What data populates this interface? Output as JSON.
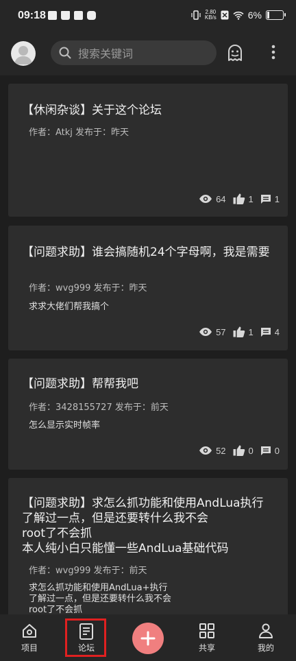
{
  "status_bar": {
    "time": "09:18",
    "speed_value": "2.80",
    "speed_unit": "KB/s",
    "battery": "6%"
  },
  "header": {
    "search_placeholder": "搜索关键词",
    "icons": [
      "avatar",
      "search-icon",
      "ghost-icon",
      "more-vertical-icon"
    ]
  },
  "posts": [
    {
      "title": "【休闲杂谈】关于这个论坛",
      "meta": "作者：Atkj  发布于：昨天",
      "excerpt_lines": [],
      "views": "64",
      "likes": "1",
      "comments": "1"
    },
    {
      "title": "【问题求助】谁会搞随机24个字母啊，我是需要",
      "meta": "作者：wvg999  发布于：昨天",
      "excerpt_lines": [
        "求求大佬们帮我搞个"
      ],
      "views": "57",
      "likes": "1",
      "comments": "4"
    },
    {
      "title": "【问题求助】帮帮我吧",
      "meta": "作者：3428155727  发布于：前天",
      "excerpt_lines": [
        "怎么显示实时帧率"
      ],
      "views": "52",
      "likes": "0",
      "comments": "0"
    },
    {
      "title_lines": [
        "【问题求助】求怎么抓功能和使用AndLua执行",
        "了解过一点，但是还要转什么我不会",
        "root了不会抓",
        "本人纯小白只能懂一些AndLua基础代码"
      ],
      "meta": "作者：wvg999  发布于：前天",
      "excerpt_lines": [
        "求怎么抓功能和使用AndLua+执行",
        "了解过一点，但是还要转什么我不会",
        "root了不会抓"
      ]
    }
  ],
  "bottom_nav": {
    "items": [
      {
        "label": "项目",
        "icon": "home-icon"
      },
      {
        "label": "论坛",
        "icon": "document-icon",
        "active": true
      },
      {
        "label": "",
        "icon": "plus-icon"
      },
      {
        "label": "共享",
        "icon": "grid-icon"
      },
      {
        "label": "我的",
        "icon": "person-icon"
      }
    ]
  },
  "colors": {
    "background": "#1e1e1e",
    "card": "#2d2d2d",
    "bar": "#262626",
    "fab": "#f07f7f",
    "highlight_frame": "#e02020"
  }
}
